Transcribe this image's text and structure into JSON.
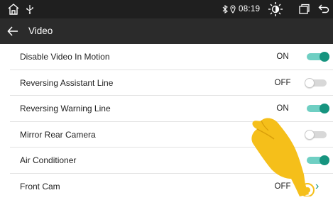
{
  "status_bar": {
    "time": "08:19",
    "icons": [
      "home-icon",
      "usb-icon",
      "bluetooth-icon",
      "location-icon",
      "brightness-icon",
      "recent-apps-icon",
      "return-icon"
    ]
  },
  "header": {
    "title": "Video",
    "back_icon": "arrow-left-icon"
  },
  "settings": [
    {
      "label": "Disable Video In Motion",
      "value": "ON",
      "control": "toggle",
      "state": "on"
    },
    {
      "label": "Reversing Assistant Line",
      "value": "OFF",
      "control": "toggle",
      "state": "off"
    },
    {
      "label": "Reversing Warning Line",
      "value": "ON",
      "control": "toggle",
      "state": "on"
    },
    {
      "label": "Mirror Rear Camera",
      "value": "",
      "control": "toggle",
      "state": "off"
    },
    {
      "label": "Air Conditioner",
      "value": "",
      "control": "toggle",
      "state": "on"
    },
    {
      "label": "Front Cam",
      "value": "OFF",
      "control": "chevron",
      "state": ""
    }
  ],
  "colors": {
    "accent": "#16947f",
    "accent_light": "#6fcfc3",
    "status_bar": "#1f1f1f",
    "title_bar": "#2b2b2b",
    "hand": "#f5bf1a"
  },
  "overlay_icon": "pointing-hand-icon"
}
